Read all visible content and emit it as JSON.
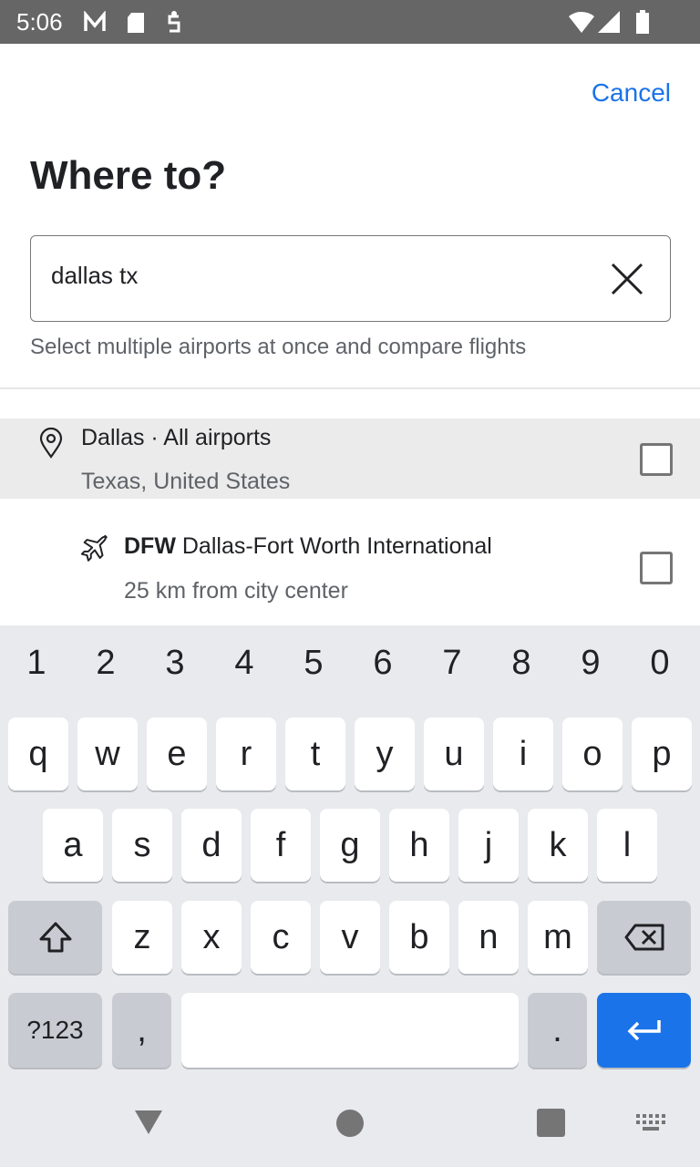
{
  "status_bar": {
    "time": "5:06",
    "icons": [
      "gmail-icon",
      "sd-card-icon",
      "debug-icon",
      "wifi-icon",
      "signal-icon",
      "battery-icon"
    ]
  },
  "header": {
    "cancel_label": "Cancel",
    "title": "Where to?"
  },
  "search": {
    "value": "dallas tx",
    "hint": "Select multiple airports at once and compare flights"
  },
  "results": [
    {
      "icon": "location-pin-icon",
      "title": "Dallas · All airports",
      "subtitle": "Texas, United States",
      "checked": false
    },
    {
      "icon": "airplane-icon",
      "code": "DFW",
      "title": "Dallas-Fort Worth International",
      "subtitle": "25 km from city center",
      "checked": false
    }
  ],
  "keyboard": {
    "numbers": [
      "1",
      "2",
      "3",
      "4",
      "5",
      "6",
      "7",
      "8",
      "9",
      "0"
    ],
    "row1": [
      "q",
      "w",
      "e",
      "r",
      "t",
      "y",
      "u",
      "i",
      "o",
      "p"
    ],
    "row2": [
      "a",
      "s",
      "d",
      "f",
      "g",
      "h",
      "j",
      "k",
      "l"
    ],
    "row3": [
      "z",
      "x",
      "c",
      "v",
      "b",
      "n",
      "m"
    ],
    "symbols_label": "?123",
    "comma": ",",
    "period": "."
  },
  "colors": {
    "accent": "#1a73e8",
    "status_bar": "#666666",
    "keyboard_bg": "#e8eaed"
  }
}
